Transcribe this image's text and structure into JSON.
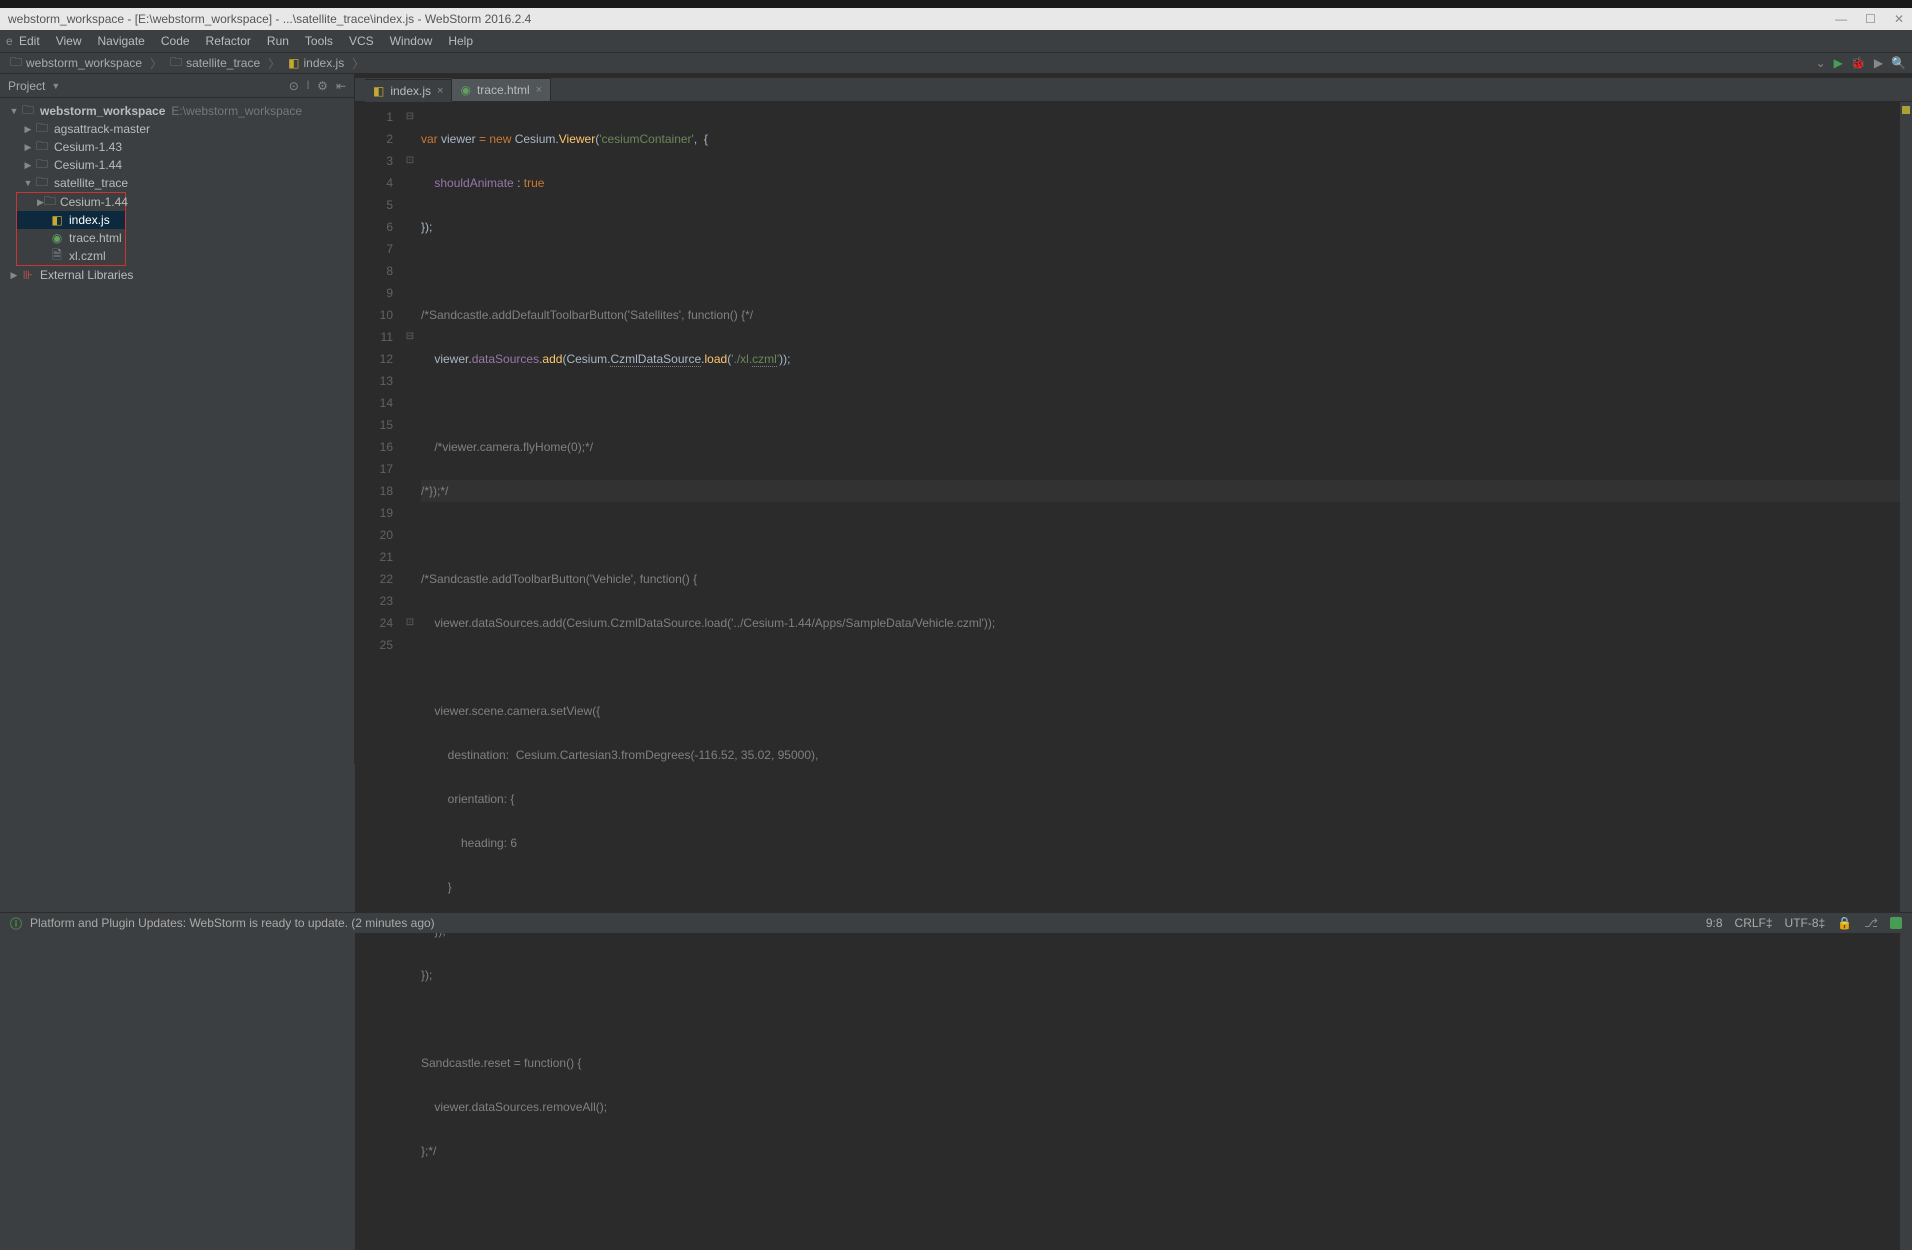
{
  "window": {
    "title": "webstorm_workspace - [E:\\webstorm_workspace] - ...\\satellite_trace\\index.js - WebStorm 2016.2.4",
    "min": "—",
    "max": "☐",
    "close": "✕"
  },
  "menu": [
    "File",
    "Edit",
    "View",
    "Navigate",
    "Code",
    "Refactor",
    "Run",
    "Tools",
    "VCS",
    "Window",
    "Help"
  ],
  "breadcrumbs": [
    {
      "icon": "folder",
      "label": "webstorm_workspace"
    },
    {
      "icon": "folder",
      "label": "satellite_trace"
    },
    {
      "icon": "js",
      "label": "index.js"
    }
  ],
  "sidebar": {
    "title": "Project",
    "root": {
      "label": "webstorm_workspace",
      "path": "E:\\webstorm_workspace"
    },
    "items": [
      {
        "label": "agsattrack-master",
        "icon": "folder",
        "indent": 1,
        "arrow": "▶"
      },
      {
        "label": "Cesium-1.43",
        "icon": "folder",
        "indent": 1,
        "arrow": "▶"
      },
      {
        "label": "Cesium-1.44",
        "icon": "folder",
        "indent": 1,
        "arrow": "▶"
      },
      {
        "label": "satellite_trace",
        "icon": "folder",
        "indent": 1,
        "arrow": "▼"
      },
      {
        "label": "Cesium-1.44",
        "icon": "folder",
        "indent": 2,
        "arrow": "▶",
        "boxed": true
      },
      {
        "label": "index.js",
        "icon": "js",
        "indent": 2,
        "selected": true,
        "boxed": true
      },
      {
        "label": "trace.html",
        "icon": "html",
        "indent": 2,
        "boxed": true
      },
      {
        "label": "xl.czml",
        "icon": "file",
        "indent": 2,
        "boxed": true
      }
    ],
    "ext_lib": "External Libraries"
  },
  "tabs": [
    {
      "icon": "js",
      "label": "index.js",
      "active": true,
      "close": "×"
    },
    {
      "icon": "html",
      "label": "trace.html",
      "active": false,
      "close": "×"
    }
  ],
  "code_lines": 25,
  "status": {
    "message": "Platform and Plugin Updates: WebStorm is ready to update. (2 minutes ago)",
    "pos": "9:8",
    "line_sep": "CRLF‡",
    "encoding": "UTF-8‡"
  },
  "code": {
    "l1": {
      "a": "var",
      "b": " viewer ",
      "c": "=",
      "d": " new ",
      "e": "Cesium.",
      "f": "Viewer",
      "g": "(",
      "h": "'cesiumContainer'",
      "i": ",  {"
    },
    "l2": {
      "a": "shouldAnimate ",
      "b": ":",
      "c": " true"
    },
    "l3": "});",
    "l5": "/*Sandcastle.addDefaultToolbarButton('Satellites', function() {*/",
    "l6": {
      "a": "    viewer.",
      "b": "dataSources",
      "c": ".",
      "d": "add",
      "e": "(Cesium.",
      "f": "CzmlDataSource",
      "g": ".",
      "h": "load",
      "i": "(",
      "j": "'./xl.",
      "k": "czml",
      "l": "'",
      "m": "));"
    },
    "l8": "    /*viewer.camera.flyHome(0);*/",
    "l9": "/*});*/",
    "l11": "/*Sandcastle.addToolbarButton('Vehicle', function() {",
    "l12": "    viewer.dataSources.add(Cesium.CzmlDataSource.load('../Cesium-1.44/Apps/SampleData/Vehicle.czml'));",
    "l14": "    viewer.scene.camera.setView({",
    "l15": "        destination:  Cesium.Cartesian3.fromDegrees(-116.52, 35.02, 95000),",
    "l16": "        orientation: {",
    "l17": "            heading: 6",
    "l18": "        }",
    "l19": "    });",
    "l20": "});",
    "l22": "Sandcastle.reset = function() {",
    "l23": "    viewer.dataSources.removeAll();",
    "l24": "};*/"
  }
}
